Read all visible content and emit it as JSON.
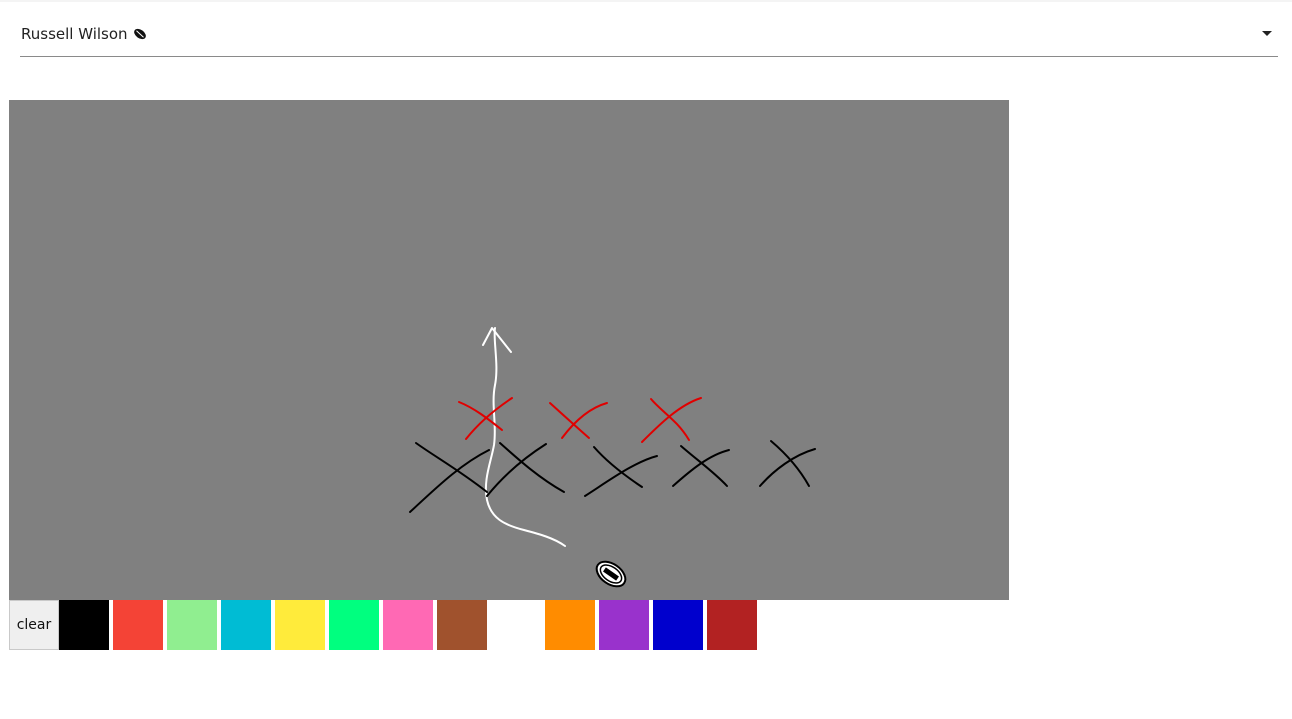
{
  "player_select": {
    "selected": "Russell Wilson",
    "icon": "football-icon"
  },
  "canvas": {
    "background": "#808080",
    "player_icon": "football-icon",
    "strokes": [
      {
        "color": "#ffffff",
        "label": "route-arrow"
      },
      {
        "color": "#ff0000",
        "label": "defense-marks"
      },
      {
        "color": "#000000",
        "label": "offense-marks"
      }
    ]
  },
  "toolbar": {
    "clear_label": "clear"
  },
  "colors": [
    {
      "name": "black",
      "hex": "#000000"
    },
    {
      "name": "red",
      "hex": "#f44336"
    },
    {
      "name": "light-green",
      "hex": "#90ee90"
    },
    {
      "name": "cyan",
      "hex": "#00bcd4"
    },
    {
      "name": "yellow",
      "hex": "#ffeb3b"
    },
    {
      "name": "spring-green",
      "hex": "#00ff7f"
    },
    {
      "name": "pink",
      "hex": "#ff69b4"
    },
    {
      "name": "brown",
      "hex": "#a0522d"
    },
    {
      "name": "white",
      "hex": "#ffffff"
    },
    {
      "name": "orange",
      "hex": "#ff8c00"
    },
    {
      "name": "purple",
      "hex": "#9932cc"
    },
    {
      "name": "blue",
      "hex": "#0000cd"
    },
    {
      "name": "firebrick",
      "hex": "#b22222"
    }
  ]
}
